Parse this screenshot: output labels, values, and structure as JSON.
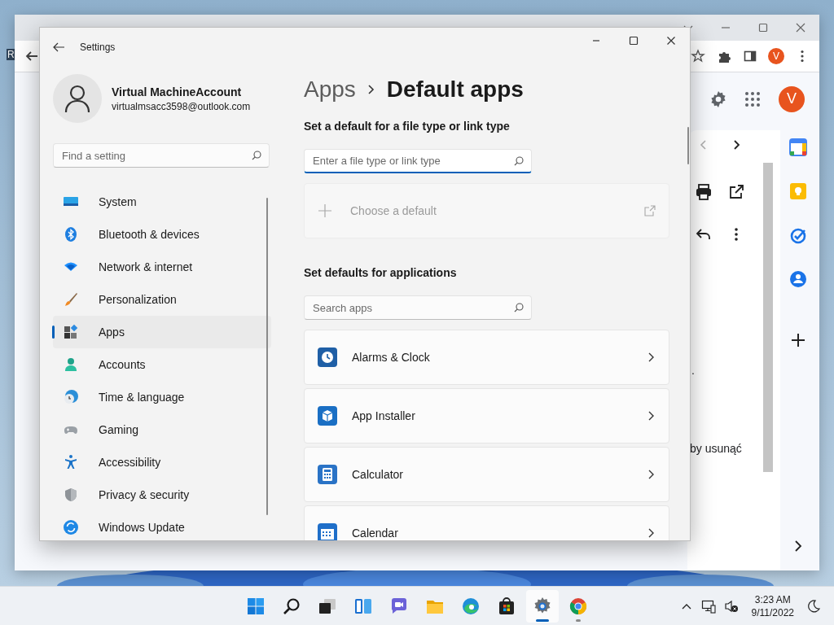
{
  "desktop": {
    "icon_labels": [
      "R"
    ]
  },
  "browser": {
    "toolbar_avatar": "V",
    "header_avatar": "V",
    "message_fragments": [
      ".",
      "by usunąć"
    ]
  },
  "settings": {
    "window": {
      "title": "Settings"
    },
    "account": {
      "name": "Virtual MachineAccount",
      "email": "virtualmsacc3598@outlook.com"
    },
    "search": {
      "placeholder": "Find a setting"
    },
    "nav_items": [
      {
        "label": "System",
        "kind": "system",
        "selected": false
      },
      {
        "label": "Bluetooth & devices",
        "kind": "bluetooth",
        "selected": false
      },
      {
        "label": "Network & internet",
        "kind": "network",
        "selected": false
      },
      {
        "label": "Personalization",
        "kind": "personalization",
        "selected": false
      },
      {
        "label": "Apps",
        "kind": "apps",
        "selected": true
      },
      {
        "label": "Accounts",
        "kind": "accounts",
        "selected": false
      },
      {
        "label": "Time & language",
        "kind": "time",
        "selected": false
      },
      {
        "label": "Gaming",
        "kind": "gaming",
        "selected": false
      },
      {
        "label": "Accessibility",
        "kind": "accessibility",
        "selected": false
      },
      {
        "label": "Privacy & security",
        "kind": "privacy",
        "selected": false
      },
      {
        "label": "Windows Update",
        "kind": "update",
        "selected": false
      }
    ],
    "breadcrumb": {
      "parent": "Apps",
      "current": "Default apps"
    },
    "file_type_section": {
      "heading": "Set a default for a file type or link type",
      "search": {
        "placeholder": "Enter a file type or link type",
        "focused": true
      },
      "choose_default": {
        "label": "Choose a default",
        "disabled": true
      }
    },
    "apps_section": {
      "heading": "Set defaults for applications",
      "search": {
        "placeholder": "Search apps"
      },
      "apps": [
        {
          "name": "Alarms & Clock",
          "kind": "alarms"
        },
        {
          "name": "App Installer",
          "kind": "installer"
        },
        {
          "name": "Calculator",
          "kind": "calculator"
        },
        {
          "name": "Calendar",
          "kind": "calendar"
        }
      ]
    }
  },
  "taskbar": {
    "apps": [
      {
        "kind": "start",
        "selected": false,
        "running": false
      },
      {
        "kind": "search",
        "selected": false,
        "running": false
      },
      {
        "kind": "taskview",
        "selected": false,
        "running": false
      },
      {
        "kind": "widgets",
        "selected": false,
        "running": false
      },
      {
        "kind": "chat",
        "selected": false,
        "running": false
      },
      {
        "kind": "explorer",
        "selected": false,
        "running": false
      },
      {
        "kind": "edge",
        "selected": false,
        "running": false
      },
      {
        "kind": "store",
        "selected": false,
        "running": false
      },
      {
        "kind": "settings",
        "selected": true,
        "running": true
      },
      {
        "kind": "chrome",
        "selected": false,
        "running": true
      }
    ],
    "clock": {
      "time": "3:23 AM",
      "date": "9/11/2022"
    }
  }
}
